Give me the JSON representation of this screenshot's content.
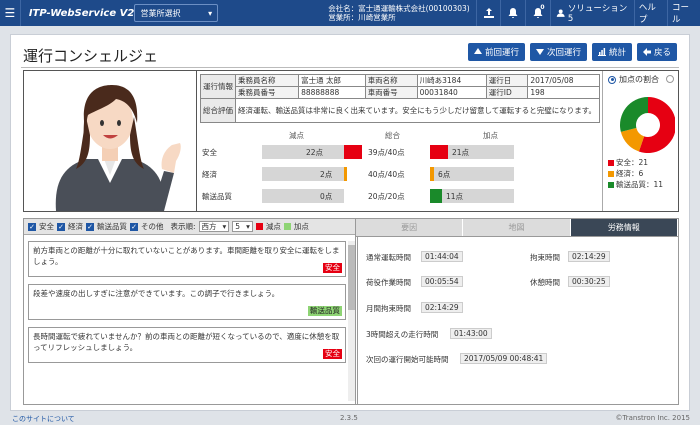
{
  "header": {
    "app_name": "ITP-WebService V2",
    "office_select": "営業所選択",
    "company_line": "会社名：富士通運輸株式会社(00100303)",
    "office_line": "営業所：川崎営業所",
    "notify_badge": "0",
    "user_name": "ソリューション5",
    "help": "ヘルプ",
    "call": "コール"
  },
  "page": {
    "title": "運行コンシェルジェ",
    "buttons": {
      "prev": "前回運行",
      "next": "次回運行",
      "stats": "統計",
      "back": "戻る"
    }
  },
  "info": {
    "group_label": "運行情報",
    "driver_name_label": "乗務員名称",
    "driver_name": "富士通 太郎",
    "vehicle_name_label": "車両名称",
    "vehicle_name": "川崎あ3184",
    "date_label": "運行日",
    "date": "2017/05/08",
    "driver_no_label": "乗務員番号",
    "driver_no": "88888888",
    "vehicle_no_label": "車両番号",
    "vehicle_no": "00031840",
    "trip_id_label": "運行ID",
    "trip_id": "198",
    "eval_label": "総合評価",
    "eval_text": "経済運転、輸送品質は非常に良く出来ています。安全にもう少しだけ留意して運転すると完璧になります。"
  },
  "scores": {
    "headers": {
      "deduct": "減点",
      "total": "総合",
      "add": "加点"
    },
    "rows": [
      {
        "label": "安全",
        "deduct_text": "22点",
        "deduct": 22,
        "total": "39点/40点",
        "add_text": "21点",
        "add": 21,
        "color": "#e60012"
      },
      {
        "label": "経済",
        "deduct_text": "2点",
        "deduct": 2,
        "total": "40点/40点",
        "add_text": "6点",
        "add": 6,
        "color": "#f39800"
      },
      {
        "label": "輸送品質",
        "deduct_text": "0点",
        "deduct": 0,
        "total": "20点/20点",
        "add_text": "11点",
        "add": 11,
        "color": "#1a8a2a"
      }
    ],
    "scale_max": 30
  },
  "pie": {
    "title": "加点の割合",
    "slices": [
      {
        "label": "安全：21",
        "value": 21,
        "color": "#e60012"
      },
      {
        "label": "経済：6",
        "value": 6,
        "color": "#f39800"
      },
      {
        "label": "輸送品質：11",
        "value": 11,
        "color": "#1a8a2a"
      }
    ]
  },
  "filters": {
    "safety": "安全",
    "economy": "経済",
    "quality": "輸送品質",
    "other": "その他",
    "order_label": "表示順:",
    "order_value": "西方",
    "count_value": "5",
    "deduct_label": "減点",
    "add_label": "加点",
    "deduct_color": "#e60012",
    "add_color": "#8ed474"
  },
  "messages": [
    {
      "text": "前方車両との距離が十分に取れていないことがあります。車間距離を取り安全に運転をしましょう。",
      "tag": "安全",
      "tag_color": "red"
    },
    {
      "text": "段差や速度の出しすぎに注意ができています。この調子で行きましょう。",
      "tag": "輸送品質",
      "tag_color": "green"
    },
    {
      "text": "長時間運転で疲れていませんか？前の車両との距離が短くなっているので、適度に休憩を取ってリフレッシュしましょう。",
      "tag": "安全",
      "tag_color": "red"
    }
  ],
  "tabs": {
    "t1": "要因",
    "t2": "地図",
    "t3": "労務情報"
  },
  "labor": {
    "drive_time_label": "通常運転時間",
    "drive_time": "01:44:04",
    "restraint_label": "拘束時間",
    "restraint": "02:14:29",
    "cargo_label": "荷役作業時間",
    "cargo": "00:05:54",
    "rest_label": "休憩時間",
    "rest": "00:30:25",
    "monthly_label": "月間拘束時間",
    "monthly": "02:14:29",
    "over3h_label": "3時間超えの走行時間",
    "over3h": "01:43:00",
    "next_start_label": "次回の運行開始可能時間",
    "next_start": "2017/05/09 00:48:41"
  },
  "footer": {
    "about": "このサイトについて",
    "version": "2.3.5",
    "copyright": "©Transtron Inc. 2015"
  }
}
